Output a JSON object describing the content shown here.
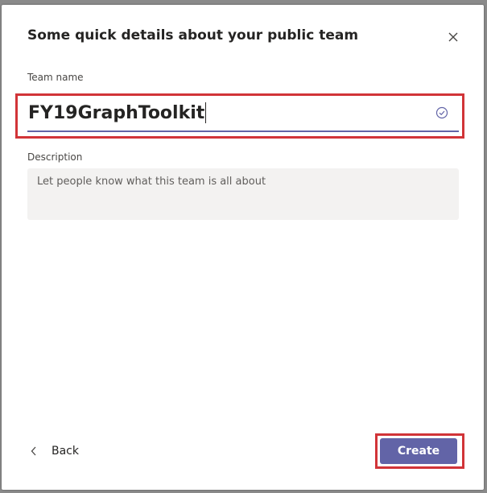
{
  "dialog": {
    "title": "Some quick details about your public team",
    "close_icon": "close-icon"
  },
  "team_name": {
    "label": "Team name",
    "value": "FY19GraphToolkit",
    "status_icon": "check-circle-icon"
  },
  "description": {
    "label": "Description",
    "placeholder": "Let people know what this team is all about"
  },
  "footer": {
    "back_icon": "chevron-left-icon",
    "back_label": "Back",
    "create_label": "Create"
  },
  "colors": {
    "accent": "#6264a7",
    "highlight": "#d13438"
  }
}
